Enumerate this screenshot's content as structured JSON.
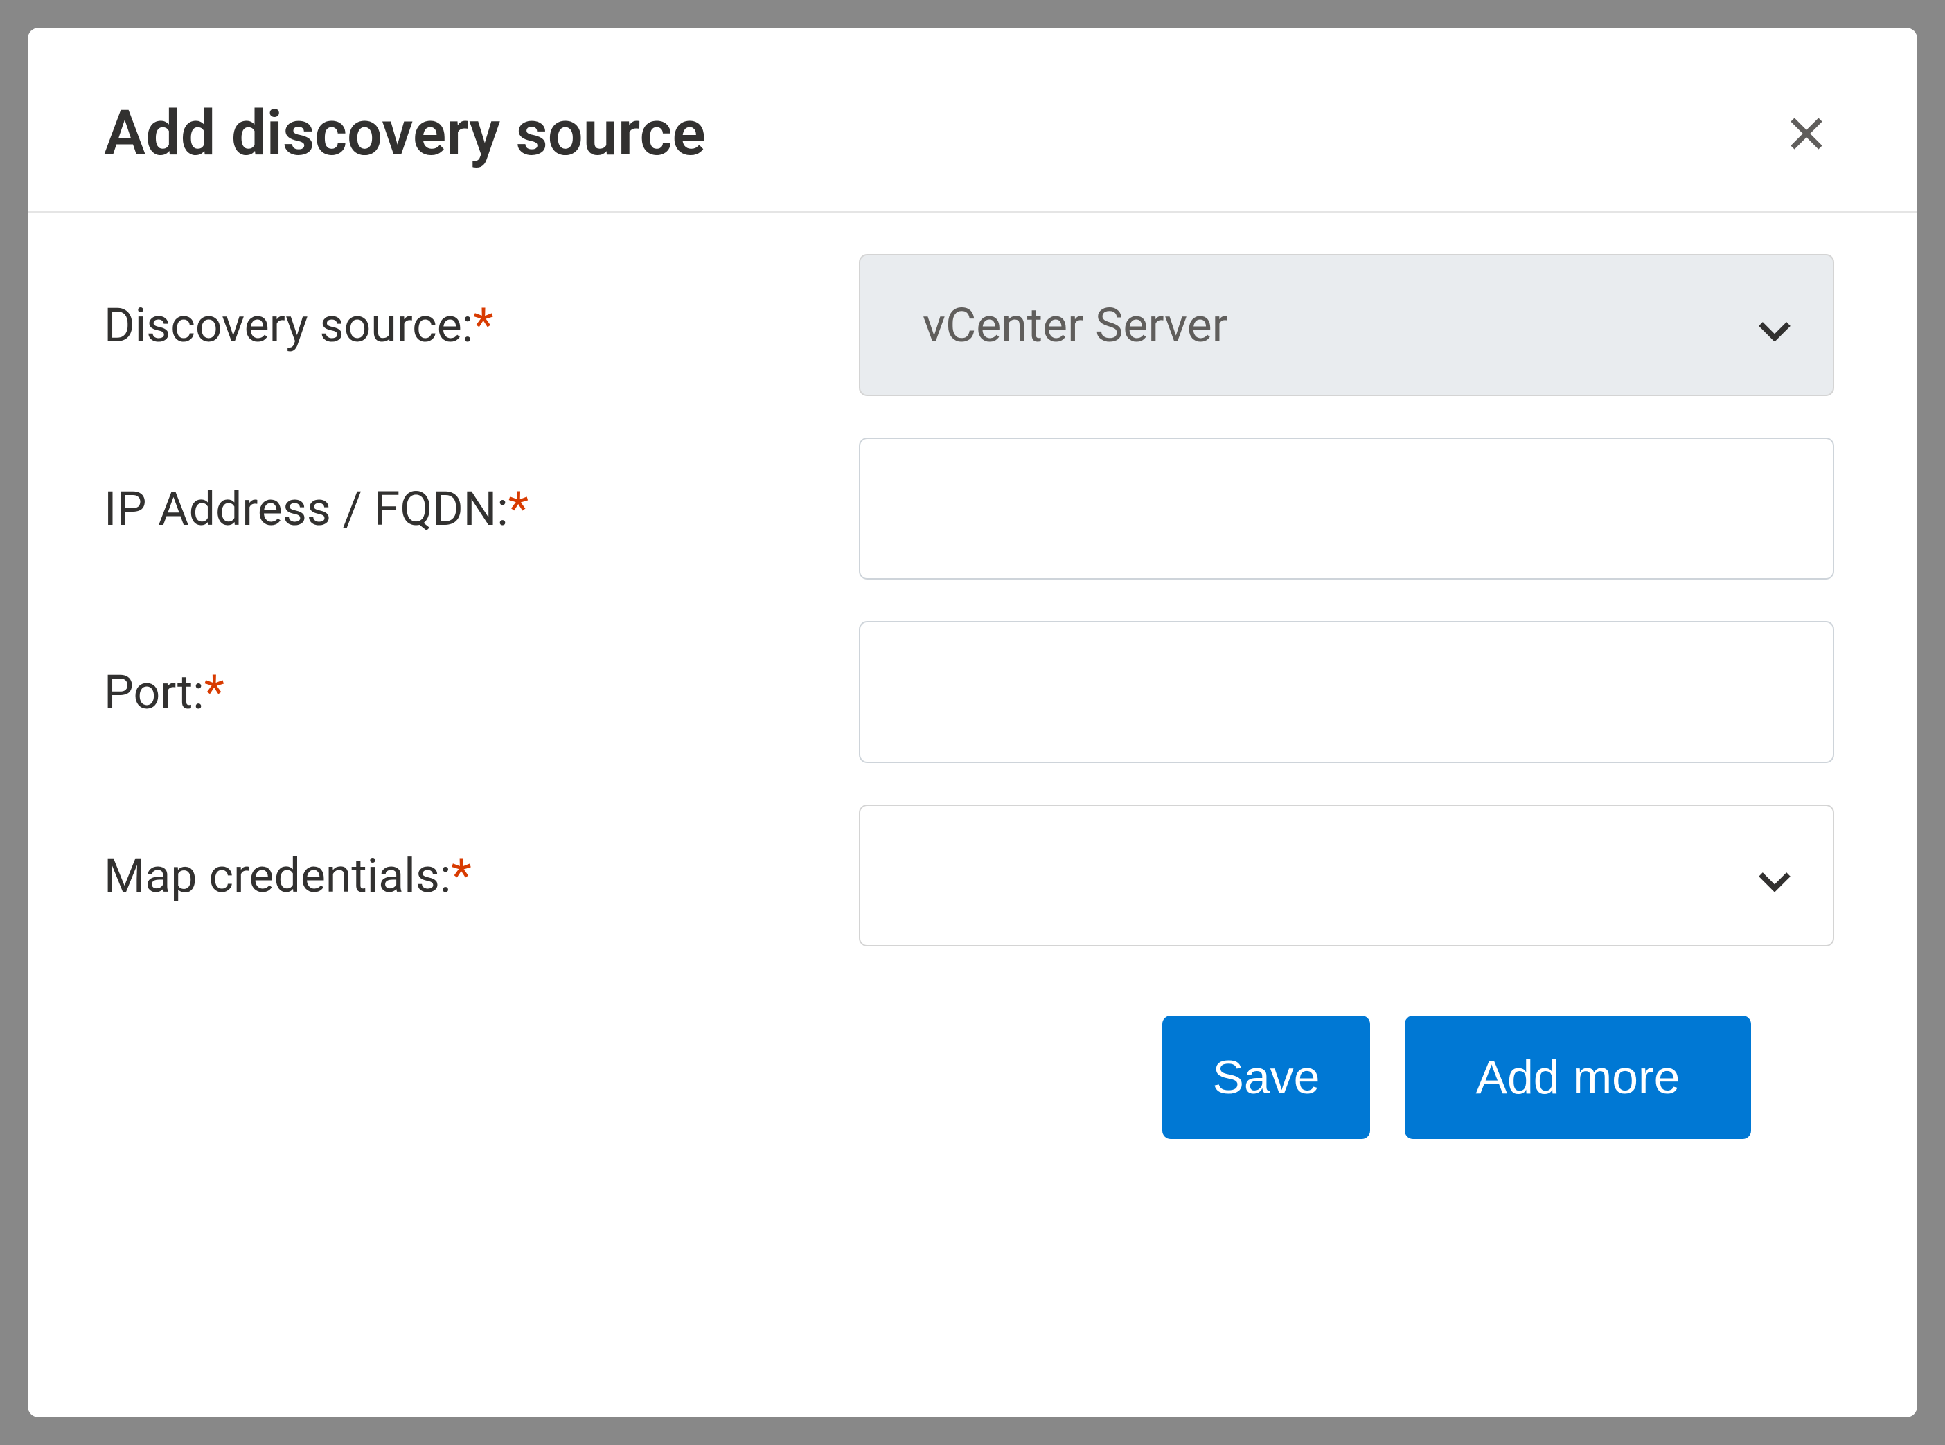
{
  "modal": {
    "title": "Add discovery source",
    "close_icon": "close-icon"
  },
  "form": {
    "discovery_source": {
      "label": "Discovery source:",
      "required_marker": "*",
      "selected_value": "vCenter Server"
    },
    "ip_address": {
      "label": "IP Address / FQDN:",
      "required_marker": "*",
      "value": ""
    },
    "port": {
      "label": "Port:",
      "required_marker": "*",
      "value": ""
    },
    "map_credentials": {
      "label": "Map credentials:",
      "required_marker": "*",
      "selected_value": ""
    }
  },
  "buttons": {
    "save": "Save",
    "add_more": "Add more"
  },
  "colors": {
    "primary": "#0078d4",
    "required": "#d83b01"
  }
}
